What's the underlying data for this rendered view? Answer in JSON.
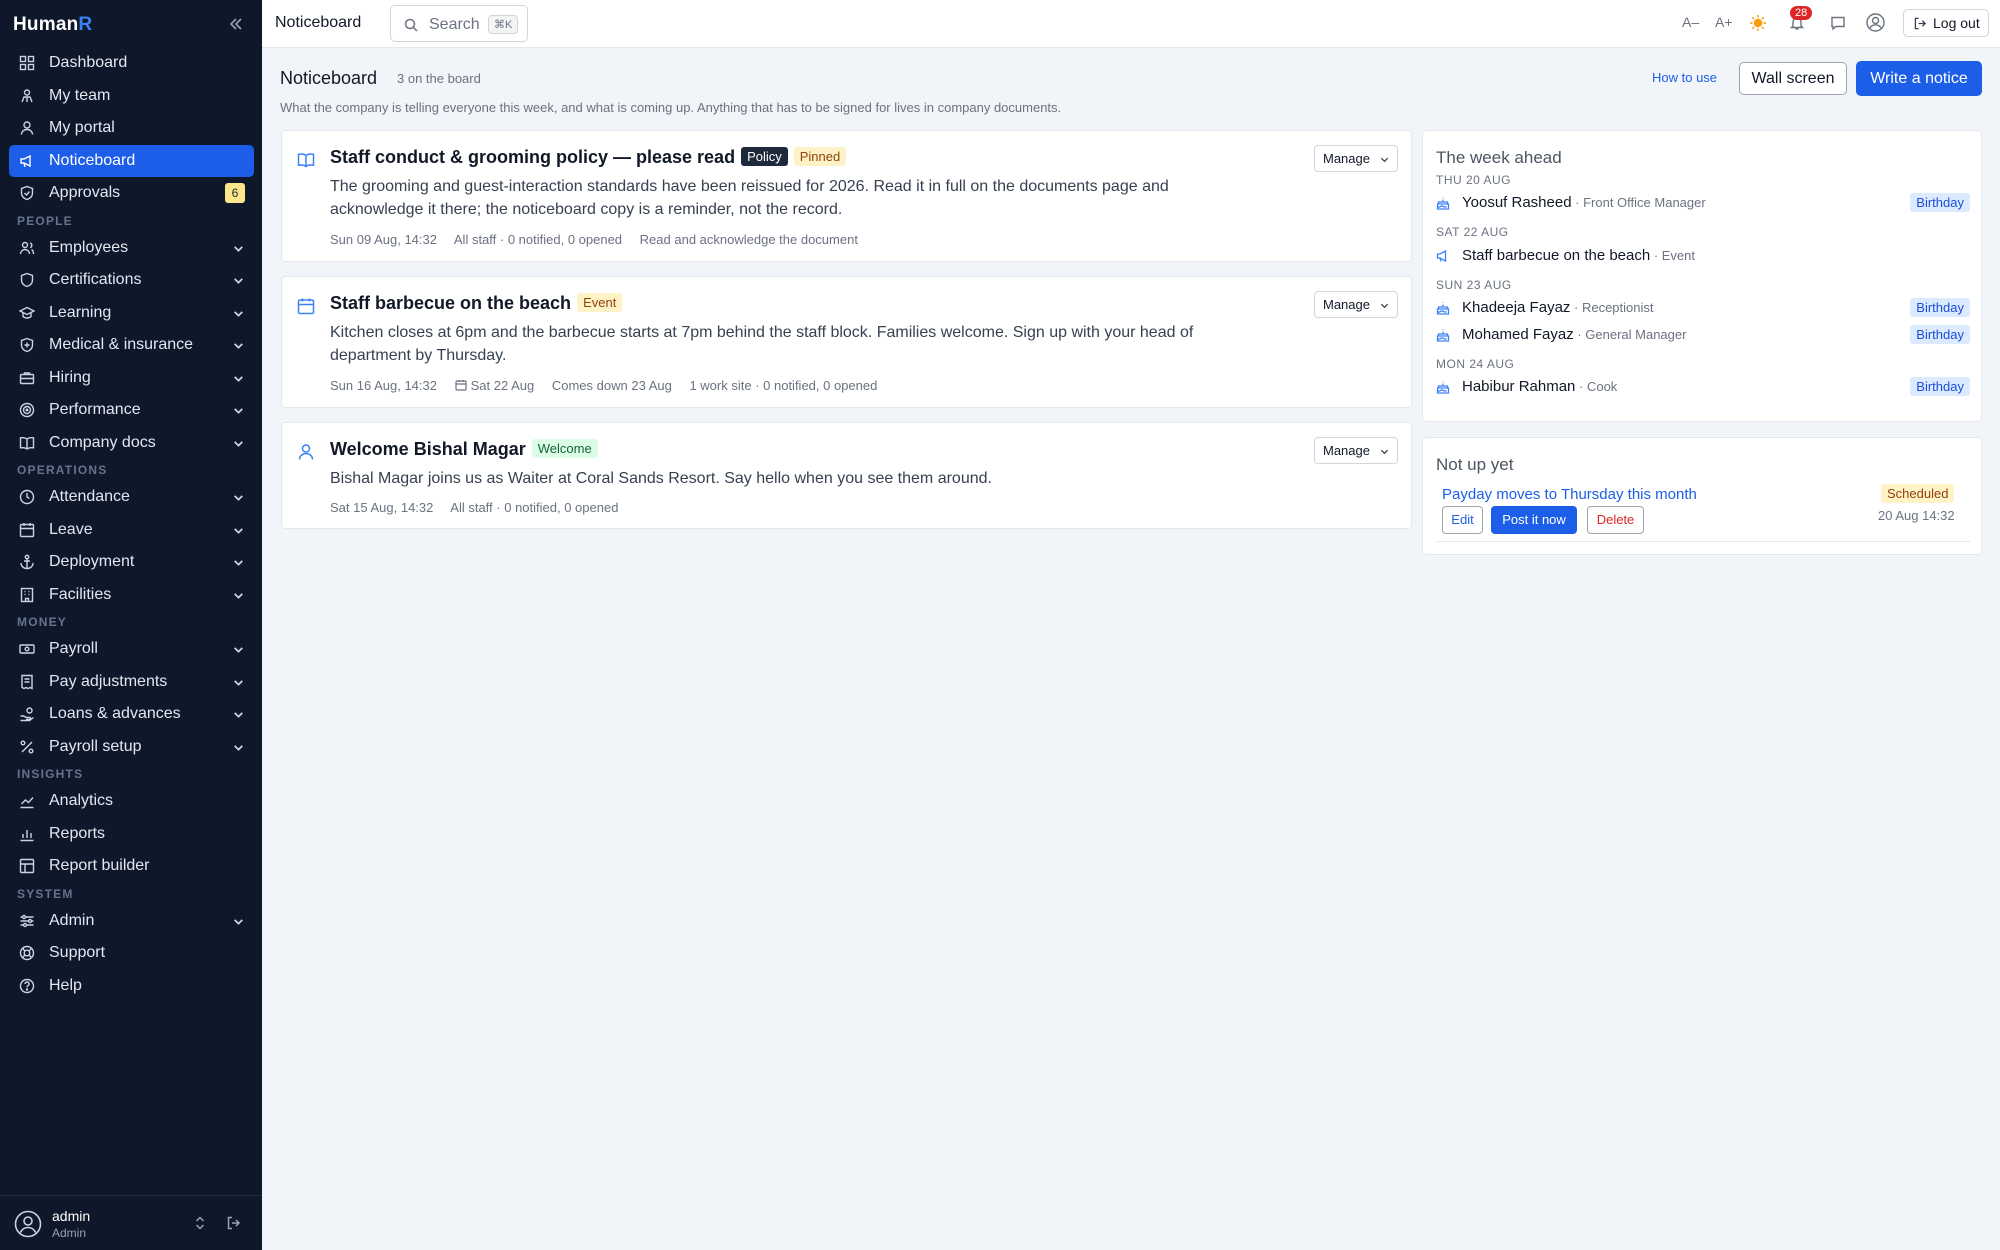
{
  "app": {
    "brand_main": "Human",
    "brand_accent": "R"
  },
  "sidebar": {
    "items": [
      {
        "label": "Dashboard"
      },
      {
        "label": "My team"
      },
      {
        "label": "My portal"
      },
      {
        "label": "Noticeboard",
        "active": true
      },
      {
        "label": "Approvals",
        "badge": "6"
      }
    ],
    "sections": [
      {
        "label": "PEOPLE",
        "items": [
          {
            "label": "Employees"
          },
          {
            "label": "Certifications"
          },
          {
            "label": "Learning"
          },
          {
            "label": "Medical & insurance"
          },
          {
            "label": "Hiring"
          },
          {
            "label": "Performance"
          },
          {
            "label": "Company docs"
          }
        ]
      },
      {
        "label": "OPERATIONS",
        "items": [
          {
            "label": "Attendance"
          },
          {
            "label": "Leave"
          },
          {
            "label": "Deployment"
          },
          {
            "label": "Facilities"
          }
        ]
      },
      {
        "label": "MONEY",
        "items": [
          {
            "label": "Payroll"
          },
          {
            "label": "Pay adjustments"
          },
          {
            "label": "Loans & advances"
          },
          {
            "label": "Payroll setup"
          }
        ]
      },
      {
        "label": "INSIGHTS",
        "items": [
          {
            "label": "Analytics"
          },
          {
            "label": "Reports"
          },
          {
            "label": "Report builder"
          }
        ]
      },
      {
        "label": "SYSTEM",
        "items": [
          {
            "label": "Admin"
          },
          {
            "label": "Support"
          },
          {
            "label": "Help"
          }
        ]
      }
    ],
    "user": {
      "name": "admin",
      "role": "Admin"
    }
  },
  "topbar": {
    "title": "Noticeboard",
    "search_placeholder": "Search",
    "search_shortcut": "⌘K",
    "font_decrease": "A–",
    "font_increase": "A+",
    "notification_count": "28",
    "logout_label": "Log out"
  },
  "page": {
    "title": "Noticeboard",
    "count": "3 on the board",
    "subtitle": "What the company is telling everyone this week, and what is coming up. Anything that has to be signed for lives in company documents.",
    "how_to_use": "How to use",
    "wall_screen": "Wall screen",
    "write_notice": "Write a notice"
  },
  "notices": [
    {
      "title": "Staff conduct & grooming policy — please read",
      "tags": [
        "Policy",
        "Pinned"
      ],
      "body": "The grooming and guest-interaction standards have been reissued for 2026. Read it in full on the documents page and acknowledge it there; the noticeboard copy is a reminder, not the record.",
      "meta": [
        "Sun 09 Aug, 14:32",
        "All staff · 0 notified, 0 opened",
        "Read and acknowledge the document"
      ],
      "manage": "Manage"
    },
    {
      "title": "Staff barbecue on the beach",
      "tags": [
        "Event"
      ],
      "body": "Kitchen closes at 6pm and the barbecue starts at 7pm behind the staff block. Families welcome. Sign up with your head of department by Thursday.",
      "meta": [
        "Sun 16 Aug, 14:32",
        "Sat 22 Aug",
        "Comes down 23 Aug",
        "1 work site · 0 notified, 0 opened"
      ],
      "manage": "Manage"
    },
    {
      "title": "Welcome Bishal Magar",
      "tags": [
        "Welcome"
      ],
      "body": "Bishal Magar joins us as Waiter at Coral Sands Resort. Say hello when you see them around.",
      "meta": [
        "Sat 15 Aug, 14:32",
        "All staff · 0 notified, 0 opened"
      ],
      "manage": "Manage"
    }
  ],
  "week_ahead": {
    "title": "The week ahead",
    "days": [
      {
        "label": "THU 20 AUG",
        "rows": [
          {
            "name": "Yoosuf Rasheed",
            "role": " · Front Office Manager",
            "badge": "Birthday",
            "icon": "cake-icon"
          }
        ]
      },
      {
        "label": "SAT 22 AUG",
        "rows": [
          {
            "name": "Staff barbecue on the beach",
            "role": " · Event",
            "badge": "",
            "icon": "megaphone-icon"
          }
        ]
      },
      {
        "label": "SUN 23 AUG",
        "rows": [
          {
            "name": "Khadeeja Fayaz",
            "role": " · Receptionist",
            "badge": "Birthday",
            "icon": "cake-icon"
          },
          {
            "name": "Mohamed Fayaz",
            "role": " · General Manager",
            "badge": "Birthday",
            "icon": "cake-icon"
          }
        ]
      },
      {
        "label": "MON 24 AUG",
        "rows": [
          {
            "name": "Habibur Rahman",
            "role": " · Cook",
            "badge": "Birthday",
            "icon": "cake-icon"
          }
        ]
      }
    ]
  },
  "not_up_yet": {
    "title": "Not up yet",
    "item_title": "Payday moves to Thursday this month",
    "status": "Scheduled",
    "date": "20 Aug 14:32",
    "edit": "Edit",
    "post_now": "Post it now",
    "delete": "Delete"
  },
  "colors": {
    "accent": "#1d5ee8",
    "sidebar_bg": "#0f172a",
    "page_bg": "#f1f4f8"
  }
}
